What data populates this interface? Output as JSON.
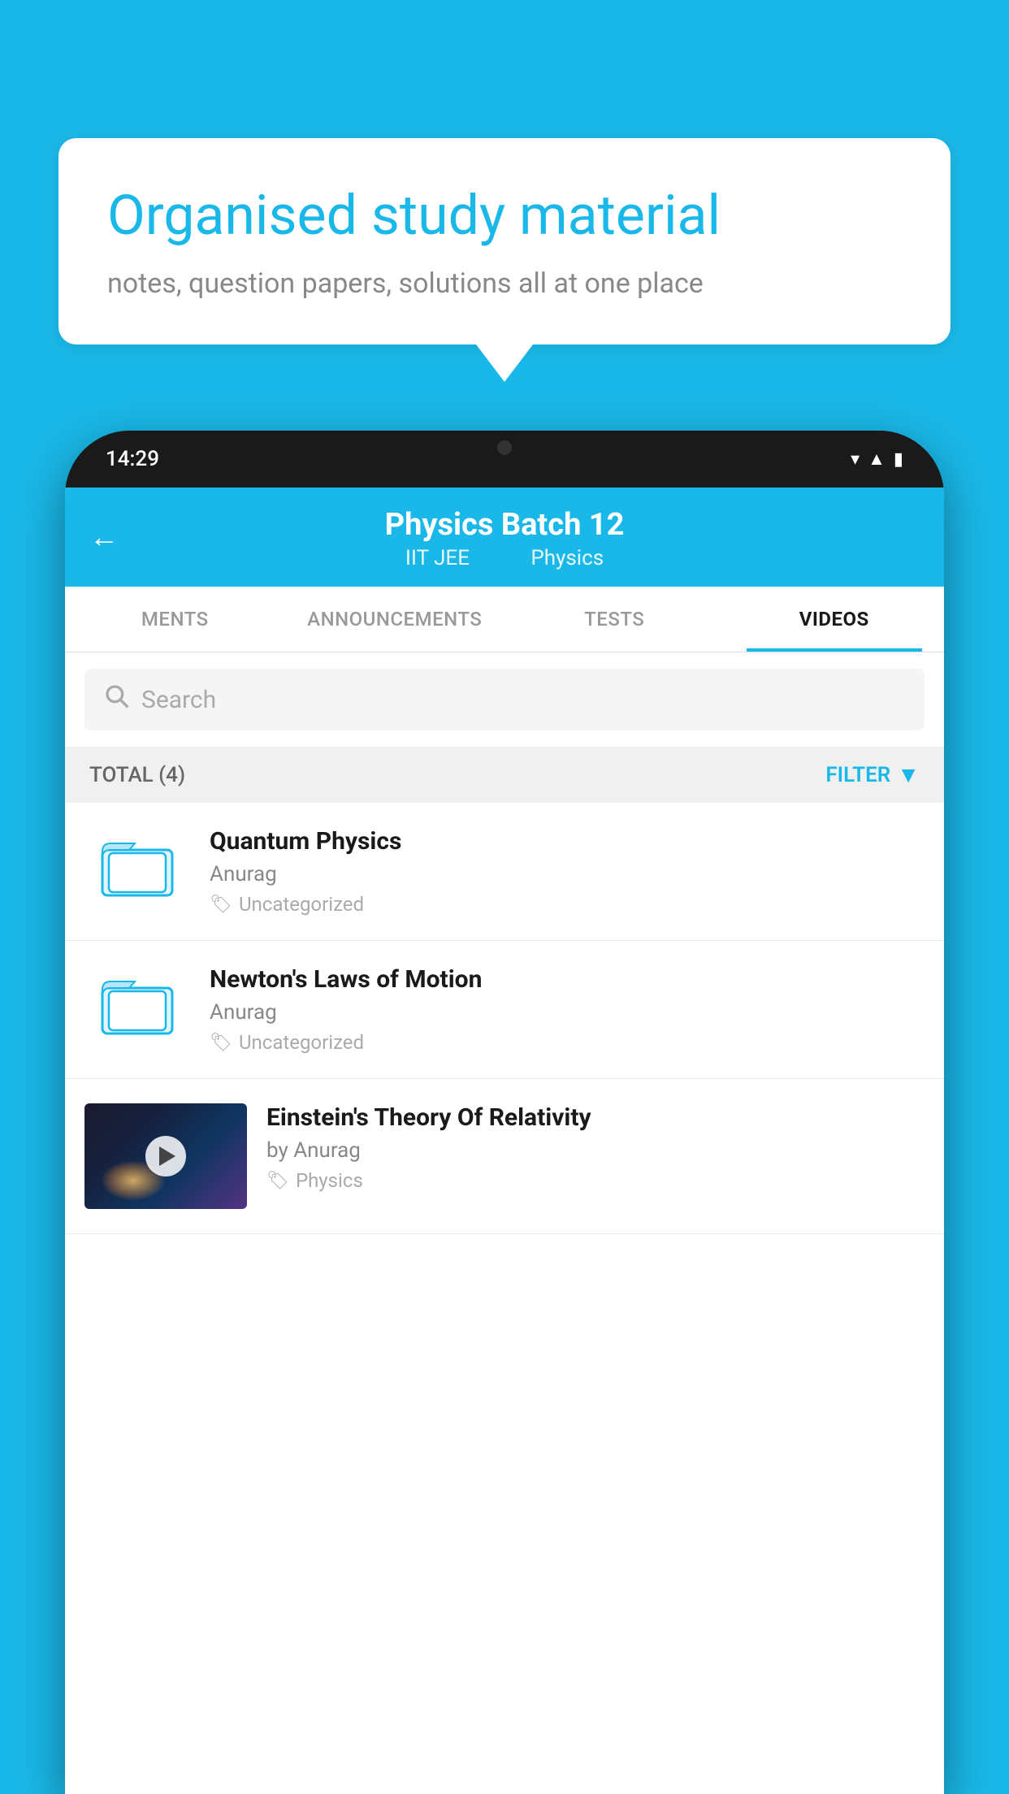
{
  "page": {
    "background_color": "#1ab8e8"
  },
  "speech_bubble": {
    "title": "Organised study material",
    "subtitle": "notes, question papers, solutions all at one place"
  },
  "phone": {
    "status_bar": {
      "time": "14:29"
    },
    "header": {
      "back_label": "←",
      "title": "Physics Batch 12",
      "subtitle_part1": "IIT JEE",
      "subtitle_part2": "Physics"
    },
    "tabs": [
      {
        "label": "MENTS",
        "active": false
      },
      {
        "label": "ANNOUNCEMENTS",
        "active": false
      },
      {
        "label": "TESTS",
        "active": false
      },
      {
        "label": "VIDEOS",
        "active": true
      }
    ],
    "search": {
      "placeholder": "Search"
    },
    "filter_bar": {
      "total_label": "TOTAL (4)",
      "filter_label": "FILTER"
    },
    "videos": [
      {
        "id": 1,
        "title": "Quantum Physics",
        "author": "Anurag",
        "tag": "Uncategorized",
        "has_thumbnail": false
      },
      {
        "id": 2,
        "title": "Newton's Laws of Motion",
        "author": "Anurag",
        "tag": "Uncategorized",
        "has_thumbnail": false
      },
      {
        "id": 3,
        "title": "Einstein's Theory Of Relativity",
        "author": "by Anurag",
        "tag": "Physics",
        "has_thumbnail": true
      }
    ]
  }
}
